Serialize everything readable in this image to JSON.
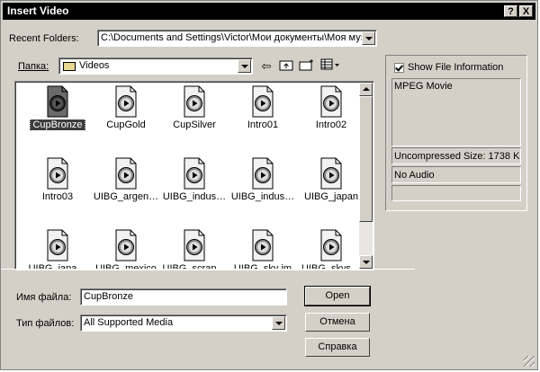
{
  "window": {
    "title": "Insert Video",
    "help_label": "?",
    "close_label": "X"
  },
  "recent": {
    "label": "Recent Folders:",
    "value": "C:\\Documents and Settings\\Victor\\Мои документы\\Моя муз"
  },
  "lookin": {
    "label": "Папка:",
    "value": "Videos",
    "toolbar_icons": [
      "back-arrow-icon",
      "up-folder-icon",
      "new-folder-icon",
      "view-menu-icon"
    ]
  },
  "files": [
    {
      "name": "CupBronze",
      "selected": true
    },
    {
      "name": "CupGold"
    },
    {
      "name": "CupSilver"
    },
    {
      "name": "Intro01"
    },
    {
      "name": "Intro02"
    },
    {
      "name": "Intro03"
    },
    {
      "name": "UIBG_argen…"
    },
    {
      "name": "UIBG_indus…"
    },
    {
      "name": "UIBG_indus…"
    },
    {
      "name": "UIBG_japan"
    },
    {
      "name": "UIBG_japa…"
    },
    {
      "name": "UIBG_mexico"
    },
    {
      "name": "UIBG_scrap…"
    },
    {
      "name": "UIBG_sky im"
    },
    {
      "name": "UIBG_skys…"
    }
  ],
  "info": {
    "show_label": "Show File Information",
    "show_checked": true,
    "type": "MPEG Movie",
    "size": "Uncompressed Size: 1738 K",
    "audio": "No Audio"
  },
  "filename": {
    "label": "Имя файла:",
    "value": "CupBronze"
  },
  "filetype": {
    "label": "Тип файлов:",
    "value": "All Supported Media"
  },
  "buttons": {
    "open": "Open",
    "cancel": "Отмена",
    "help": "Справка"
  }
}
